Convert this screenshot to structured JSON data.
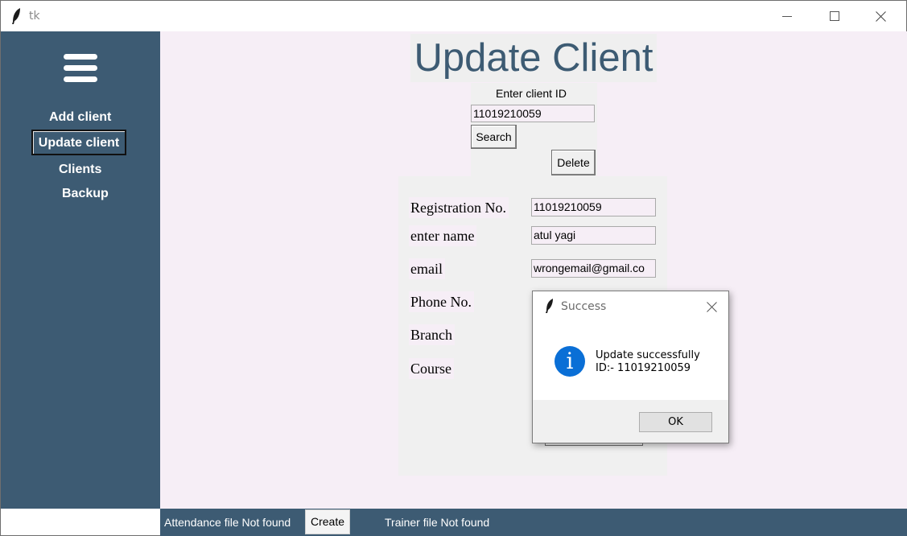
{
  "window": {
    "title": "tk"
  },
  "sidebar": {
    "items": [
      {
        "label": "Add client"
      },
      {
        "label": "Update client"
      },
      {
        "label": "Clients"
      },
      {
        "label": "Backup"
      }
    ]
  },
  "main": {
    "heading": "Update Client",
    "search": {
      "label": "Enter client ID",
      "value": "11019210059",
      "search_label": "Search",
      "delete_label": "Delete"
    },
    "form": {
      "registration_label": "Registration No.",
      "registration_value": "11019210059",
      "name_label": "enter name",
      "name_value": "atul yagi",
      "email_label": "email",
      "email_value": "wrongemail@gmail.co",
      "phone_label": "Phone No.",
      "branch_label": "Branch",
      "course_label": "Course"
    }
  },
  "statusbar": {
    "attendance_text": "Attendance file Not found",
    "create_label": "Create",
    "trainer_text": "Trainer file Not found"
  },
  "dialog": {
    "title": "Success",
    "message_line1": "Update successfully",
    "message_line2": "ID:- 11019210059",
    "ok_label": "OK"
  },
  "colors": {
    "sidebar": "#3d5b73",
    "main_bg": "#f6eef6",
    "info_icon": "#0a6fd6"
  }
}
